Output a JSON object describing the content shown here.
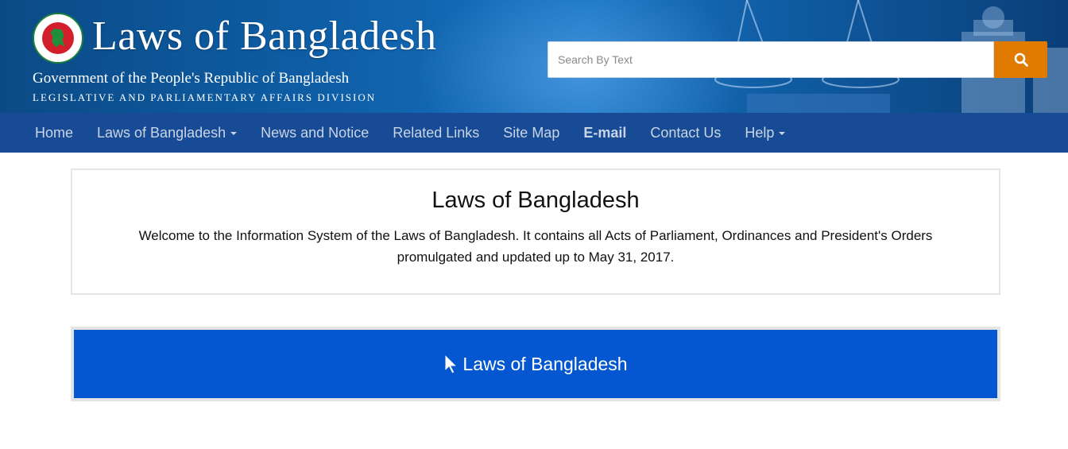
{
  "header": {
    "site_title": "Laws of Bangladesh",
    "gov_line": "Government of the People's Republic of Bangladesh",
    "division_line": "LEGISLATIVE AND PARLIAMENTARY AFFAIRS DIVISION",
    "logo_icon": "bangladesh-govt-seal-icon"
  },
  "search": {
    "placeholder": "Search By Text",
    "value": "",
    "button_icon": "search-icon",
    "button_color": "#e07b00"
  },
  "nav": {
    "items": [
      {
        "label": "Home"
      },
      {
        "label": "Laws of Bangladesh",
        "dropdown": true
      },
      {
        "label": "News and Notice"
      },
      {
        "label": "Related Links"
      },
      {
        "label": "Site Map"
      },
      {
        "label": "E-mail",
        "bold": true
      },
      {
        "label": "Contact Us"
      },
      {
        "label": "Help",
        "dropdown": true
      }
    ],
    "bg_color": "#174b95"
  },
  "welcome": {
    "title": "Laws of Bangladesh",
    "text": "Welcome to the Information System of the Laws of Bangladesh. It contains all Acts of Parliament, Ordinances and President's Orders promulgated and updated up to May 31, 2017."
  },
  "cta": {
    "label": "Laws of Bangladesh",
    "icon": "pointer-cursor-icon",
    "color": "#0457d1"
  }
}
